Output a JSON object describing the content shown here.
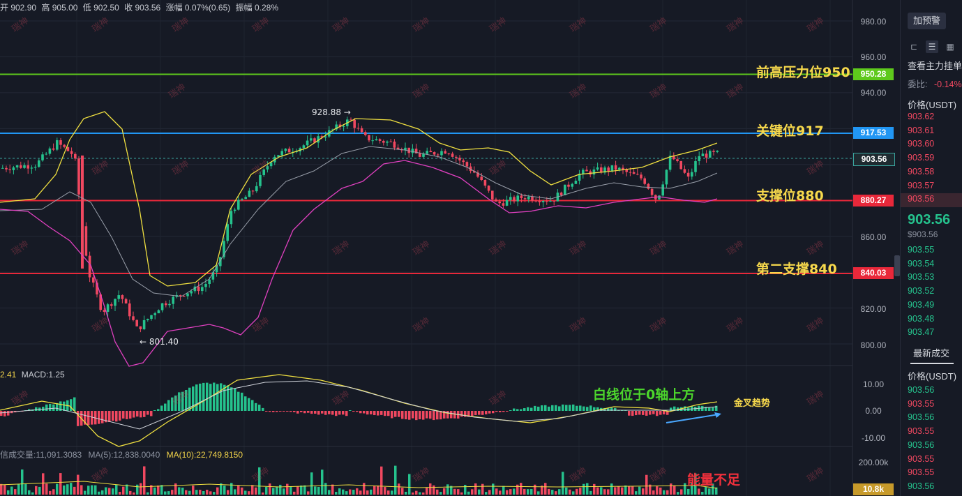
{
  "ohlc": {
    "prefix": "开",
    "open": "开 902.90",
    "high": "高 905.00",
    "low": "低 902.50",
    "close": "收 903.56",
    "change": "涨幅 0.07%(0.65)",
    "amplitude": "振幅 0.28%"
  },
  "macd_label": {
    "dif": "2.41",
    "macd": "MACD:1.25"
  },
  "volume_label": {
    "vol": "信成交量:11,091.3083",
    "ma5": "MA(5):12,838.0040",
    "ma10": "MA(10):22,749.8150"
  },
  "y_axis": {
    "price_ticks": [
      "980.00",
      "960.00",
      "940.00",
      "860.00",
      "820.00",
      "800.00"
    ],
    "macd_ticks": [
      "10.00",
      "0.00",
      "-10.00"
    ],
    "vol_ticks": [
      "200.00k"
    ]
  },
  "price_boxes": [
    {
      "label": "950.28",
      "color": "#5ec91c"
    },
    {
      "label": "917.53",
      "color": "#2196f3"
    },
    {
      "label": "903.56",
      "color": "#1e2a30"
    },
    {
      "label": "880.27",
      "color": "#e8283a"
    },
    {
      "label": "840.03",
      "color": "#e8283a"
    },
    {
      "label": "10.8k",
      "color": "#c79a2a"
    }
  ],
  "annotations": {
    "resistance": "前高压力位950",
    "key_level": "关键位917",
    "support": "支撑位880",
    "support2": "第二支撑840",
    "macd_note": "白线位于0轴上方",
    "golden_cross": "金叉趋势",
    "volume_note": "能量不足",
    "high_marker": "928.88 →",
    "low_marker": "← 801.40",
    "watermark": "瑞神"
  },
  "colors": {
    "bg": "#161a25",
    "up": "#25c28d",
    "down": "#f04860",
    "green_line": "#5ec91c",
    "blue_line": "#2196f3",
    "red_line": "#e8283a",
    "boll_upper": "#f0e040",
    "boll_lower": "#e040c0",
    "boll_mid": "#9aa0ab"
  },
  "sidebar": {
    "alert_button": "加预警",
    "icons": [
      "left-align-icon",
      "list-icon",
      "grid-icon",
      "menu-icon"
    ],
    "view_orders": "查看主力挂单",
    "ratio_label": "委比:",
    "ratio_value": "-0.14%",
    "price_header": "价格(USDT)",
    "asks": [
      "903.62",
      "903.61",
      "903.60",
      "903.59",
      "903.58",
      "903.57",
      "903.56"
    ],
    "last_price": "903.56",
    "last_price_usd": "$903.56",
    "bids": [
      "903.55",
      "903.54",
      "903.53",
      "903.52",
      "903.49",
      "903.48",
      "903.47"
    ],
    "trades_tab": "最新成交",
    "trades_header": "价格(USDT)",
    "trades": [
      {
        "p": "903.56",
        "side": "up"
      },
      {
        "p": "903.55",
        "side": "down"
      },
      {
        "p": "903.56",
        "side": "up"
      },
      {
        "p": "903.55",
        "side": "down"
      },
      {
        "p": "903.56",
        "side": "up"
      },
      {
        "p": "903.55",
        "side": "down"
      },
      {
        "p": "903.55",
        "side": "down"
      },
      {
        "p": "903.56",
        "side": "up"
      }
    ]
  }
}
